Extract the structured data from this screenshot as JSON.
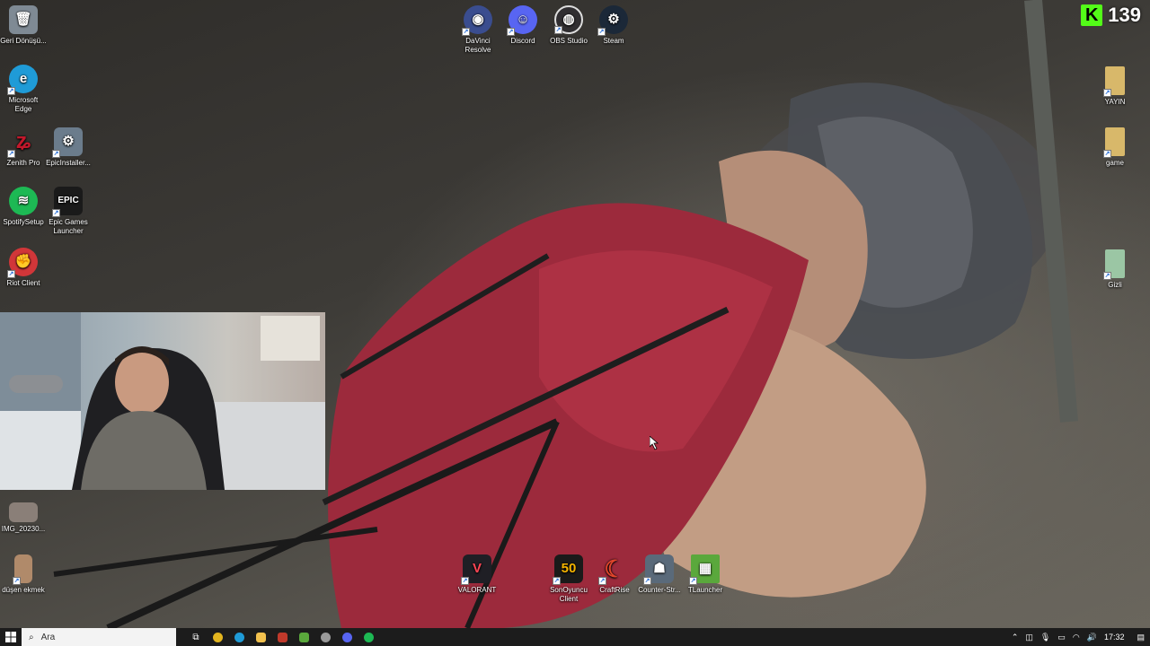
{
  "desktop": {
    "left_icons": [
      {
        "label": "Geri Dönüşü...",
        "icon": "recycle-bin-icon",
        "color": "#7f8a94"
      },
      {
        "label": "Microsoft Edge",
        "icon": "edge-icon",
        "color": "#1f9bd7"
      },
      {
        "label": "Zenith Pro",
        "icon": "zenith-icon",
        "color": "#c2182b"
      },
      {
        "label": "EpicInstaller...",
        "icon": "installer-icon",
        "color": "#6b7c8c"
      },
      {
        "label": "SpotifySetup",
        "icon": "spotify-icon",
        "color": "#1db954"
      },
      {
        "label": "Epic Games Launcher",
        "icon": "epic-games-icon",
        "color": "#1a1a1a"
      },
      {
        "label": "Riot Client",
        "icon": "riot-client-icon",
        "color": "#d13639"
      },
      {
        "label": "IMG_20230...",
        "icon": "image-file-icon",
        "color": "#8a7f78"
      },
      {
        "label": "düşen ekmek",
        "icon": "image-file-icon",
        "color": "#b08a6a"
      }
    ],
    "top_icons": [
      {
        "label": "DaVinci Resolve",
        "icon": "davinci-icon",
        "color": "#3a4d8f"
      },
      {
        "label": "Discord",
        "icon": "discord-icon",
        "color": "#5865f2"
      },
      {
        "label": "OBS Studio",
        "icon": "obs-icon",
        "color": "#302e31"
      },
      {
        "label": "Steam",
        "icon": "steam-icon",
        "color": "#1b2838"
      }
    ],
    "right_icons": [
      {
        "label": "YAYIN",
        "icon": "folder-icon",
        "color": "#d8b86a"
      },
      {
        "label": "game",
        "icon": "folder-icon",
        "color": "#d8b86a"
      },
      {
        "label": "Gizli",
        "icon": "folder-icon",
        "color": "#9bc6a4"
      }
    ],
    "bottom_icons": [
      {
        "label": "VALORANT",
        "icon": "valorant-icon",
        "color": "#1f1f25"
      },
      {
        "label": "SonOyuncu Client",
        "icon": "sonoyuncu-icon",
        "color": "#1a1a1a"
      },
      {
        "label": "CraftRise",
        "icon": "craftrise-icon",
        "color": "#e0452b"
      },
      {
        "label": "Counter-Str...",
        "icon": "counter-strike-icon",
        "color": "#5a6a7a"
      },
      {
        "label": "TLauncher",
        "icon": "tlauncher-icon",
        "color": "#5aa83c"
      }
    ]
  },
  "overlay": {
    "counter_logo": "K",
    "counter_value": "139",
    "counter_color": "#53fc18"
  },
  "taskbar": {
    "search_placeholder": "Ara",
    "time": "17:32",
    "apps": [
      {
        "icon": "task-view-icon",
        "color": "#cccccc"
      },
      {
        "icon": "chrome-icon",
        "color": "#e3b51f"
      },
      {
        "icon": "edge-icon",
        "color": "#1f9bd7"
      },
      {
        "icon": "file-explorer-icon",
        "color": "#f2c14e"
      },
      {
        "icon": "app-red-icon",
        "color": "#c0392b"
      },
      {
        "icon": "app-green-icon",
        "color": "#5aa83c"
      },
      {
        "icon": "obs-icon",
        "color": "#999999"
      },
      {
        "icon": "discord-icon",
        "color": "#5865f2"
      },
      {
        "icon": "spotify-icon",
        "color": "#1db954"
      }
    ]
  }
}
